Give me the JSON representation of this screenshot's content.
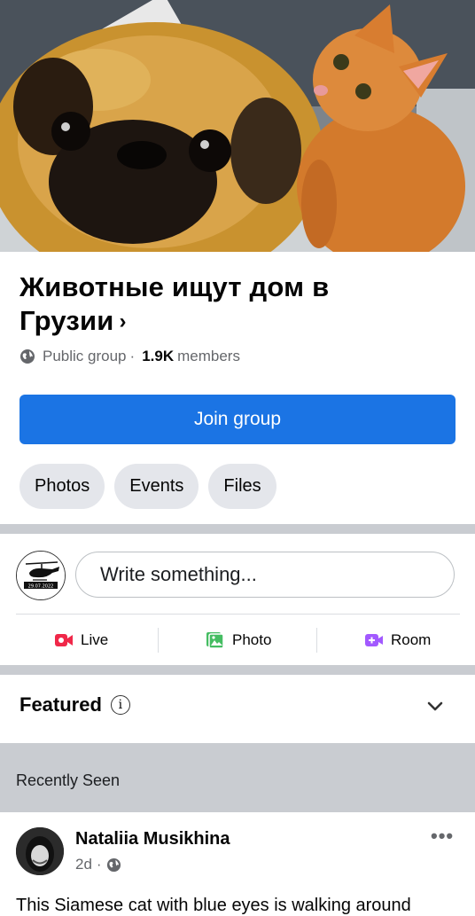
{
  "group": {
    "title_line1": "Животные ищут дом в",
    "title_line2": "Грузии",
    "privacy": "Public group",
    "separator": "·",
    "members_count": "1.9K",
    "members_label": "members"
  },
  "buttons": {
    "join": "Join group"
  },
  "tabs": [
    "Photos",
    "Events",
    "Files"
  ],
  "composer": {
    "avatar_caption": "29.07.2022",
    "placeholder": "Write something...",
    "actions": [
      {
        "label": "Live",
        "icon": "live-video-icon",
        "color": "#f02849"
      },
      {
        "label": "Photo",
        "icon": "photo-icon",
        "color": "#45bd62"
      },
      {
        "label": "Room",
        "icon": "room-icon",
        "color": "#a259ff"
      }
    ]
  },
  "featured": {
    "title": "Featured",
    "info_glyph": "i"
  },
  "recent": {
    "label": "Recently Seen"
  },
  "post": {
    "author": "Nataliia Musikhina",
    "time": "2d",
    "separator": "·",
    "text": "This Siamese cat with blue eyes is walking around"
  },
  "colors": {
    "primary": "#1b74e4",
    "chip": "#e4e6eb",
    "divider": "#c9ccd1"
  }
}
